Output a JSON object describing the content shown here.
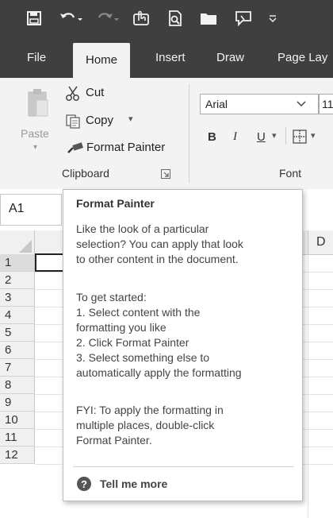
{
  "quick_access": {
    "icons": [
      "save-icon",
      "undo-icon",
      "redo-icon",
      "touch-mode-icon",
      "print-preview-icon",
      "open-folder-icon",
      "comment-icon",
      "customize-qat-icon"
    ]
  },
  "tabs": [
    "File",
    "Home",
    "Insert",
    "Draw",
    "Page Lay"
  ],
  "active_tab": "Home",
  "ribbon": {
    "clipboard": {
      "paste_label": "Paste",
      "cut_label": "Cut",
      "copy_label": "Copy",
      "format_painter_label": "Format Painter",
      "group_label": "Clipboard"
    },
    "font": {
      "font_name": "Arial",
      "font_size": "11",
      "bold": "B",
      "italic": "I",
      "underline": "U",
      "group_label": "Font"
    }
  },
  "name_box": "A1",
  "grid": {
    "visible_column": "D",
    "rows": [
      "1",
      "2",
      "3",
      "4",
      "5",
      "6",
      "7",
      "8",
      "9",
      "10",
      "11",
      "12"
    ]
  },
  "tooltip": {
    "title": "Format Painter",
    "lines": [
      "Like the look of a particular",
      "selection? You can apply that look",
      "to other content in the document.",
      "To get started:",
      "1. Select content with the",
      "formatting you like",
      "2. Click Format Painter",
      "3. Select something else to",
      "automatically apply the formatting",
      "FYI: To apply the formatting in",
      "multiple places, double-click",
      "Format Painter."
    ],
    "tell_me_more": "Tell me more"
  },
  "colors": {
    "title_bar": "#3f3f3f",
    "ribbon_bg": "#f3f3f3"
  }
}
